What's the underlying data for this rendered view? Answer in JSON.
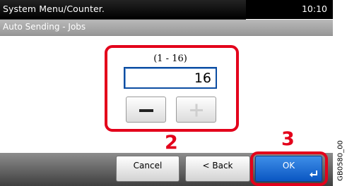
{
  "header": {
    "title": "System Menu/Counter.",
    "time": "10:10"
  },
  "subheader": {
    "title": "Auto Sending - Jobs"
  },
  "input": {
    "range": "(1 - 16)",
    "value": "16"
  },
  "stepper": {
    "minus_icon": "minus-icon",
    "plus_icon": "plus-icon",
    "plus_state": "disabled"
  },
  "footer": {
    "cancel_label": "Cancel",
    "back_label": "< Back",
    "ok_label": "OK",
    "enter_icon": "enter-icon"
  },
  "callouts": {
    "step2": "2",
    "step3": "3"
  },
  "figure_code": "GB0580_00",
  "colors": {
    "highlight": "#e3001b",
    "ok_button": "#0a56c2",
    "input_border": "#0c4da2"
  }
}
